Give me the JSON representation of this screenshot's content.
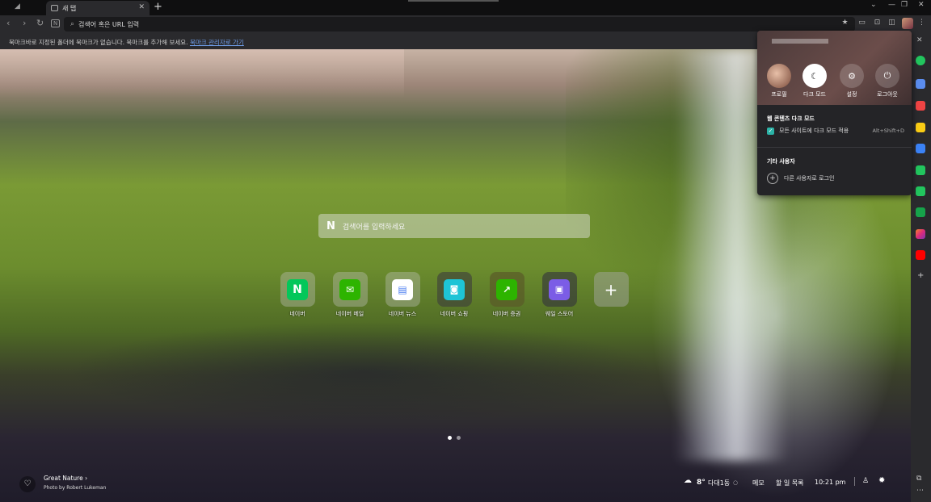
{
  "tab": {
    "title": "새 탭"
  },
  "address_bar": {
    "placeholder": "검색어 혹은 URL 입력"
  },
  "bookmark_bar": {
    "message": "북마크바로 지정된 폴더에 북마크가 없습니다. 북마크를 추가해 보세요.",
    "link": "북마크 관리자로 가기"
  },
  "search": {
    "logo": "N",
    "placeholder": "검색어를 입력하세요"
  },
  "shortcuts": [
    {
      "label": "네이버",
      "color": "#03c75a",
      "glyph": "N"
    },
    {
      "label": "네이버 메일",
      "color": "#2db400",
      "glyph": "✉"
    },
    {
      "label": "네이버 뉴스",
      "color": "#4a7cf0",
      "glyph": "▤"
    },
    {
      "label": "네이버 쇼핑",
      "color": "#1ec4d6",
      "glyph": "🛍"
    },
    {
      "label": "네이버 증권",
      "color": "#2db400",
      "glyph": "↗"
    },
    {
      "label": "웨일 스토어",
      "color": "#7b5ce6",
      "glyph": "▣"
    }
  ],
  "add_shortcut": {
    "glyph": "+"
  },
  "photo": {
    "title": "Great Nature",
    "credit": "Photo by Robert Lukeman"
  },
  "weather": {
    "temp": "8°",
    "location": "다대1동"
  },
  "bottom_links": {
    "memo": "메모",
    "todo": "할 일 목록"
  },
  "clock": "10:21 pm",
  "popup": {
    "username": "",
    "buttons": [
      {
        "label": "프로필",
        "icon": "avatar"
      },
      {
        "label": "다크 모드",
        "icon": "moon-icon"
      },
      {
        "label": "설정",
        "icon": "gear-icon"
      },
      {
        "label": "로그아웃",
        "icon": "power-icon"
      }
    ],
    "dark_section": {
      "title": "웹 콘텐츠 다크 모드",
      "option": "모든 사이트에 다크 모드 적용",
      "shortcut": "Alt+Shift+D"
    },
    "other_section": {
      "title": "기타 사용자",
      "option": "다른 사용자로 로그인"
    }
  },
  "sidebar_colors": [
    "#22c55e",
    "#5b8def",
    "#ef4444",
    "#facc15",
    "#3b82f6",
    "#22c55e",
    "#22c55e",
    "#16a34a",
    "#e1306c",
    "#ff0000"
  ]
}
